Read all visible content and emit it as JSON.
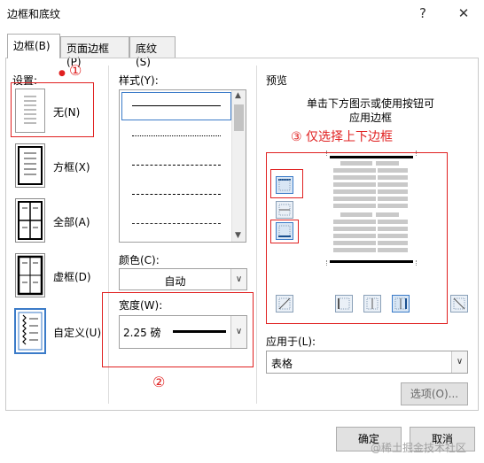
{
  "window": {
    "title": "边框和底纹",
    "help_label": "?",
    "close_label": "✕"
  },
  "tabs": [
    {
      "label": "边框(B)",
      "active": true
    },
    {
      "label": "页面边框(P)",
      "active": false
    },
    {
      "label": "底纹(S)",
      "active": false
    }
  ],
  "settings": {
    "heading": "设置:",
    "items": [
      {
        "label": "无(N)",
        "selected": true
      },
      {
        "label": "方框(X)"
      },
      {
        "label": "全部(A)"
      },
      {
        "label": "虚框(D)"
      },
      {
        "label": "自定义(U)"
      }
    ]
  },
  "style": {
    "heading": "样式(Y):",
    "lines": [
      "solid",
      "dotted",
      "dashed",
      "long-dashed",
      "dash-dot"
    ]
  },
  "color": {
    "label": "颜色(C):",
    "value": "自动"
  },
  "width": {
    "label": "宽度(W):",
    "value": "2.25 磅"
  },
  "preview": {
    "heading": "预览",
    "hint_line1": "单击下方图示或使用按钮可",
    "hint_line2": "应用边框"
  },
  "apply_to": {
    "label": "应用于(L):",
    "value": "表格"
  },
  "options_button": "选项(O)...",
  "ok_button": "确定",
  "cancel_button": "取消",
  "annotations": {
    "circle1": "①",
    "circle2": "②",
    "note3": "③ 仅选择上下边框"
  },
  "watermark": "@稀土掘金技术社区",
  "colors": {
    "annotation_red": "#e02020",
    "accent_blue": "#3b7bc8"
  }
}
